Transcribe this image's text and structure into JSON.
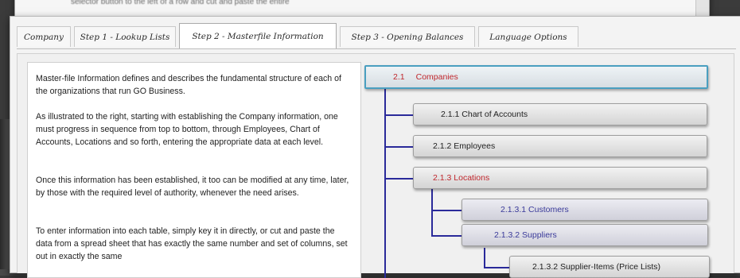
{
  "background_window": {
    "text": "selector button to the left of a row and cut and paste the entire"
  },
  "tabs": [
    {
      "label": "Company",
      "active": false
    },
    {
      "label": "Step 1 - Lookup Lists",
      "active": false
    },
    {
      "label": "Step 2 - Masterfile Information",
      "active": true
    },
    {
      "label": "Step 3 - Opening Balances",
      "active": false
    },
    {
      "label": "Language Options",
      "active": false
    }
  ],
  "description": {
    "paragraphs": [
      "Master-file Information defines and describes the fundamental structure of each of the organizations that run GO Business.",
      "As illustrated to the right, starting with establishing the Company information, one must progress in sequence from top to bottom, through Employees, Chart of Accounts, Locations and so forth, entering the appropriate data at each level.",
      "Once this information has been established, it too can be modified at any time, later, by those with the required level of authority, whenever the need arises.",
      "To enter information into each table, simply key it in directly, or cut and paste the data from a spread sheet that has exactly the same number and set of columns, set out in exactly the same"
    ]
  },
  "tree": {
    "root": {
      "number": "2.1",
      "label": "Companies"
    },
    "nodes": [
      {
        "label": "2.1.1  Chart of Accounts",
        "style": "normal"
      },
      {
        "label": "2.1.2  Employees",
        "style": "normal"
      },
      {
        "label": "2.1.3  Locations",
        "style": "red"
      },
      {
        "label": "2.1.3.1  Customers",
        "style": "blue"
      },
      {
        "label": "2.1.3.2  Suppliers",
        "style": "blue"
      },
      {
        "label": "2.1.3.2  Supplier-Items (Price Lists)",
        "style": "normal"
      }
    ]
  },
  "colors": {
    "accent_red": "#c0272d",
    "tree_line": "#2a2a9a",
    "root_border": "#4a9fc0"
  }
}
